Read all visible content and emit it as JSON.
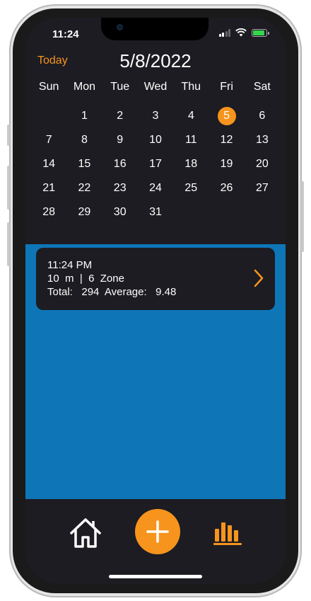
{
  "status_bar": {
    "time": "11:24"
  },
  "header": {
    "today_label": "Today",
    "date_title": "5/8/2022"
  },
  "calendar": {
    "weekdays": [
      "Sun",
      "Mon",
      "Tue",
      "Wed",
      "Thu",
      "Fri",
      "Sat"
    ],
    "weeks": [
      [
        "",
        "1",
        "2",
        "3",
        "4",
        "5",
        "6"
      ],
      [
        "7",
        "8",
        "9",
        "10",
        "11",
        "12",
        "13"
      ],
      [
        "14",
        "15",
        "16",
        "17",
        "18",
        "19",
        "20"
      ],
      [
        "21",
        "22",
        "23",
        "24",
        "25",
        "26",
        "27"
      ],
      [
        "28",
        "29",
        "30",
        "31",
        "",
        "",
        ""
      ]
    ],
    "selected_day": "5"
  },
  "entry": {
    "time": "11:24 PM",
    "detail": "10  m  |  6  Zone",
    "summary": "Total:   294  Average:   9.48"
  },
  "tabbar": {
    "home_icon": "house-icon",
    "add_icon": "plus-icon",
    "stats_icon": "bar-chart-icon"
  },
  "colors": {
    "accent": "#f7941d",
    "background": "#1c1c22",
    "list_area": "#0e76b7"
  }
}
